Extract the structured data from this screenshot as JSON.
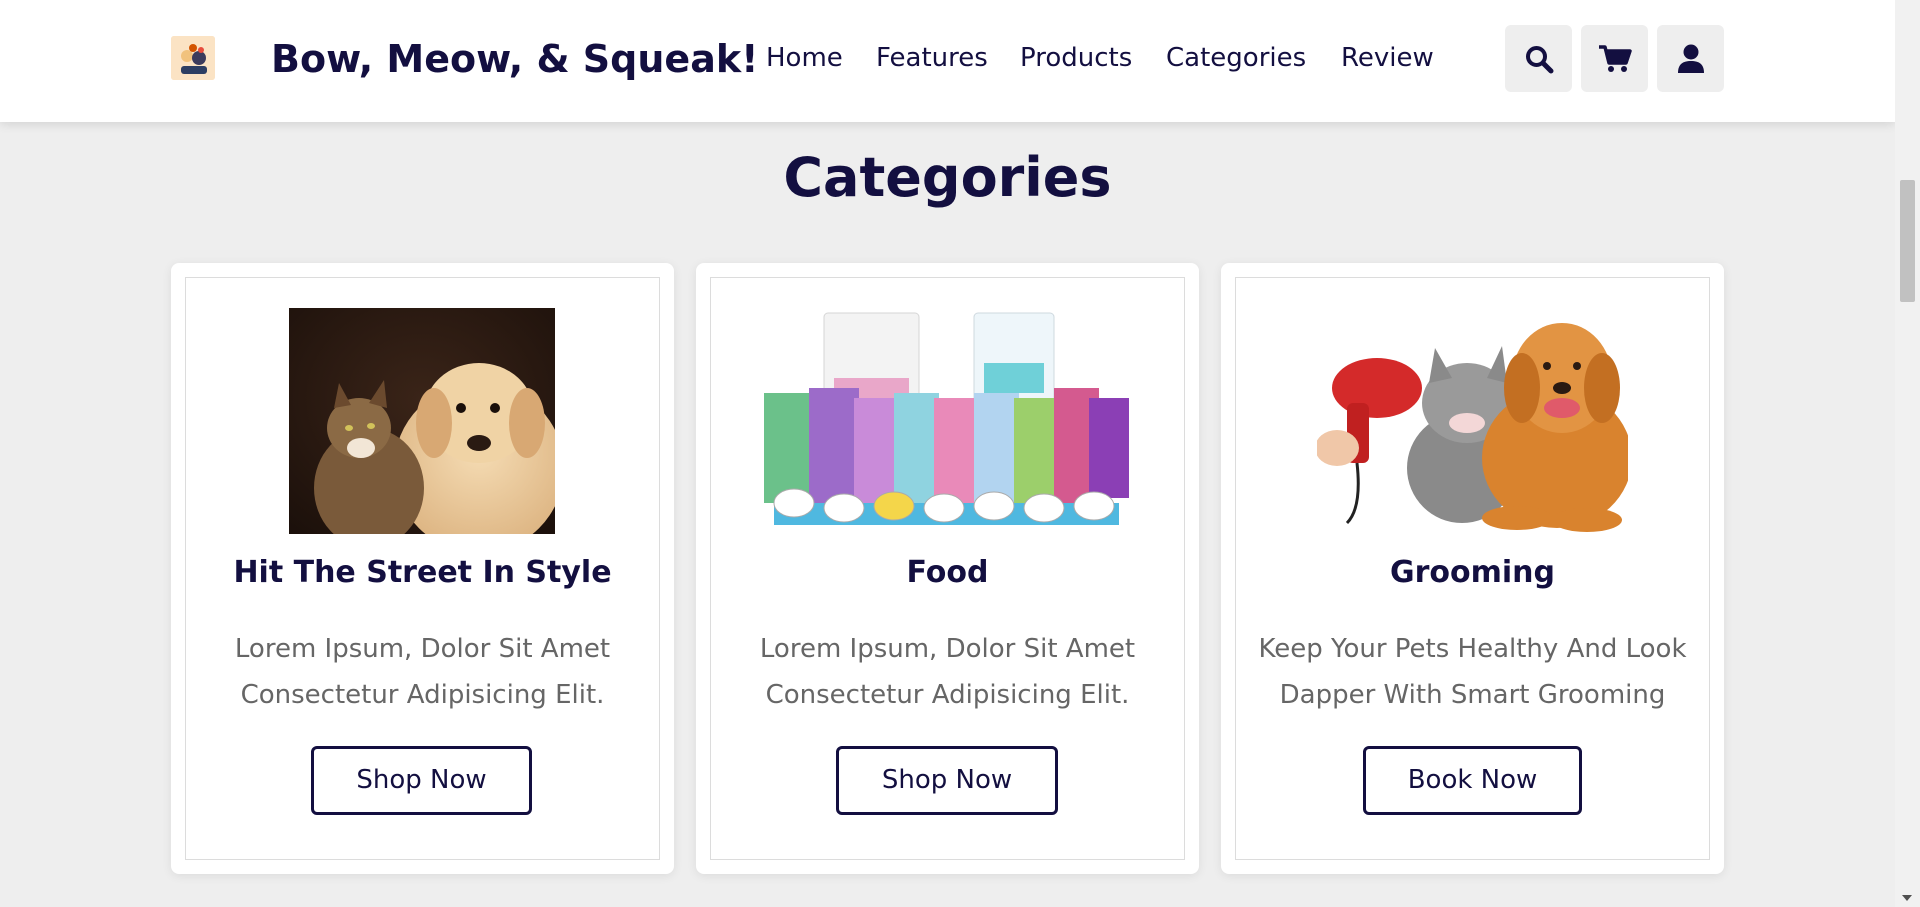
{
  "header": {
    "brand": "Bow, Meow, & Squeak!",
    "logo_icon": "pet-logo-icon",
    "nav": [
      "Home",
      "Features",
      "Products",
      "Categories",
      "Review"
    ],
    "icons": [
      "search-icon",
      "cart-icon",
      "user-icon"
    ]
  },
  "section": {
    "title": "Categories"
  },
  "cards": [
    {
      "title": "Hit The Street In Style",
      "desc_line1": "Lorem Ipsum, Dolor Sit Amet",
      "desc_line2": "Consectetur Adipisicing Elit.",
      "button": "Shop Now",
      "image": "cat-and-dog-photo"
    },
    {
      "title": "Food",
      "desc_line1": "Lorem Ipsum, Dolor Sit Amet",
      "desc_line2": "Consectetur Adipisicing Elit.",
      "button": "Shop Now",
      "image": "pet-food-products-photo"
    },
    {
      "title": "Grooming",
      "desc_line1": "Keep Your Pets Healthy And Look",
      "desc_line2": "Dapper With Smart Grooming",
      "button": "Book Now",
      "image": "grooming-pets-photo"
    }
  ],
  "colors": {
    "primary": "#130f40",
    "background": "#eeeeee",
    "text_muted": "#666666"
  }
}
